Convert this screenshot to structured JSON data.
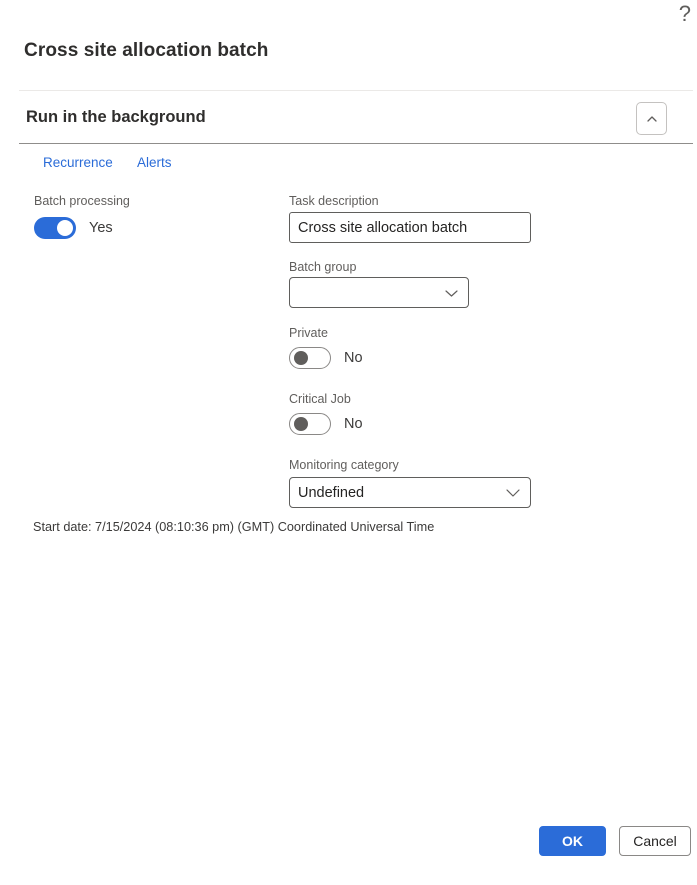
{
  "dialog": {
    "help_icon": "?",
    "title": "Cross site allocation batch",
    "section": {
      "title": "Run in the background"
    },
    "tabs": [
      {
        "label": "Recurrence"
      },
      {
        "label": "Alerts"
      }
    ],
    "fields": {
      "batch_processing": {
        "label": "Batch processing",
        "value": "Yes",
        "state": "on"
      },
      "task_description": {
        "label": "Task description",
        "value": "Cross site allocation batch"
      },
      "batch_group": {
        "label": "Batch group",
        "value": ""
      },
      "private": {
        "label": "Private",
        "value": "No",
        "state": "off"
      },
      "critical_job": {
        "label": "Critical Job",
        "value": "No",
        "state": "off"
      },
      "monitoring_category": {
        "label": "Monitoring category",
        "value": "Undefined"
      }
    },
    "start_date_text": "Start date: 7/15/2024 (08:10:36 pm) (GMT) Coordinated Universal Time",
    "footer": {
      "ok_label": "OK",
      "cancel_label": "Cancel"
    },
    "colors": {
      "accent_blue": "#2b6cd8",
      "label_gray": "#605e5c",
      "border_gray": "#8a8886",
      "text_dark": "#323130"
    }
  }
}
